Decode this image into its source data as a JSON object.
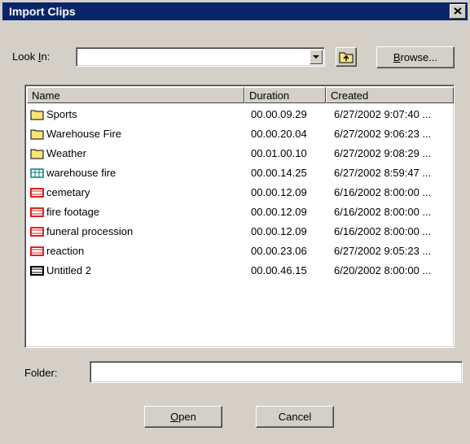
{
  "dialog": {
    "title": "Import Clips"
  },
  "look_in": {
    "label_pre": "Look ",
    "label_mnemonic": "I",
    "label_post": "n:",
    "value": ""
  },
  "buttons": {
    "browse_mnemonic": "B",
    "browse_rest": "rowse...",
    "open_mnemonic": "O",
    "open_rest": "pen",
    "cancel": "Cancel"
  },
  "columns": [
    "Name",
    "Duration",
    "Created"
  ],
  "rows": [
    {
      "icon": "folder-icon",
      "name": "Sports",
      "duration": "00.00.09.29",
      "created": "6/27/2002 9:07:40 ..."
    },
    {
      "icon": "folder-icon",
      "name": "Warehouse Fire",
      "duration": "00.00.20.04",
      "created": "6/27/2002 9:06:23 ..."
    },
    {
      "icon": "folder-icon",
      "name": "Weather",
      "duration": "00.01.00.10",
      "created": "6/27/2002 9:08:29 ..."
    },
    {
      "icon": "storyboard-icon",
      "name": "warehouse fire",
      "duration": "00.00.14.25",
      "created": "6/27/2002 8:59:47 ..."
    },
    {
      "icon": "video-clip-icon",
      "name": "cemetary",
      "duration": "00.00.12.09",
      "created": "6/16/2002 8:00:00 ..."
    },
    {
      "icon": "video-clip-icon",
      "name": "fire footage",
      "duration": "00.00.12.09",
      "created": "6/16/2002 8:00:00 ..."
    },
    {
      "icon": "video-clip-icon",
      "name": "funeral procession",
      "duration": "00.00.12.09",
      "created": "6/16/2002 8:00:00 ..."
    },
    {
      "icon": "video-clip-icon",
      "name": "reaction",
      "duration": "00.00.23.06",
      "created": "6/27/2002 9:05:23 ..."
    },
    {
      "icon": "project-icon",
      "name": "Untitled 2",
      "duration": "00.00.46.15",
      "created": "6/20/2002 8:00:00 ..."
    }
  ],
  "folder": {
    "label": "Folder:",
    "value": ""
  },
  "colors": {
    "titlebar": "#0a246a",
    "face": "#d4d0c8",
    "folder": "#f7e47b",
    "clip_red": "#e02020",
    "storyboard_teal": "#008080"
  }
}
